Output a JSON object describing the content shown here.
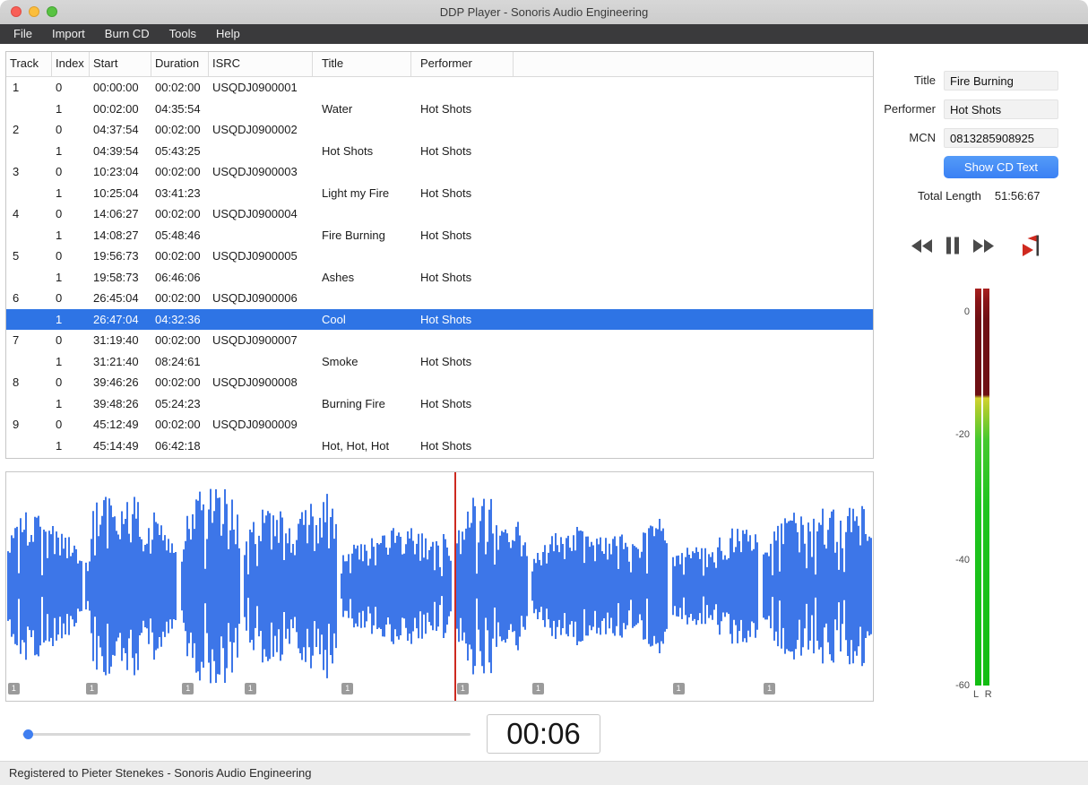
{
  "window": {
    "title": "DDP Player - Sonoris Audio Engineering"
  },
  "menu": {
    "items": [
      "File",
      "Import",
      "Burn CD",
      "Tools",
      "Help"
    ]
  },
  "table": {
    "columns": [
      "Track",
      "Index",
      "Start",
      "Duration",
      "ISRC",
      "Title",
      "Performer"
    ],
    "selected_row": 11,
    "rows": [
      {
        "track": "1",
        "index": "0",
        "start": "00:00:00",
        "duration": "00:02:00",
        "isrc": "USQDJ0900001",
        "title": "",
        "performer": ""
      },
      {
        "track": "",
        "index": "1",
        "start": "00:02:00",
        "duration": "04:35:54",
        "isrc": "",
        "title": "Water",
        "performer": "Hot Shots"
      },
      {
        "track": "2",
        "index": "0",
        "start": "04:37:54",
        "duration": "00:02:00",
        "isrc": "USQDJ0900002",
        "title": "",
        "performer": ""
      },
      {
        "track": "",
        "index": "1",
        "start": "04:39:54",
        "duration": "05:43:25",
        "isrc": "",
        "title": "Hot Shots",
        "performer": "Hot Shots"
      },
      {
        "track": "3",
        "index": "0",
        "start": "10:23:04",
        "duration": "00:02:00",
        "isrc": "USQDJ0900003",
        "title": "",
        "performer": ""
      },
      {
        "track": "",
        "index": "1",
        "start": "10:25:04",
        "duration": "03:41:23",
        "isrc": "",
        "title": "Light my Fire",
        "performer": "Hot Shots"
      },
      {
        "track": "4",
        "index": "0",
        "start": "14:06:27",
        "duration": "00:02:00",
        "isrc": "USQDJ0900004",
        "title": "",
        "performer": ""
      },
      {
        "track": "",
        "index": "1",
        "start": "14:08:27",
        "duration": "05:48:46",
        "isrc": "",
        "title": "Fire Burning",
        "performer": "Hot Shots"
      },
      {
        "track": "5",
        "index": "0",
        "start": "19:56:73",
        "duration": "00:02:00",
        "isrc": "USQDJ0900005",
        "title": "",
        "performer": ""
      },
      {
        "track": "",
        "index": "1",
        "start": "19:58:73",
        "duration": "06:46:06",
        "isrc": "",
        "title": "Ashes",
        "performer": "Hot Shots"
      },
      {
        "track": "6",
        "index": "0",
        "start": "26:45:04",
        "duration": "00:02:00",
        "isrc": "USQDJ0900006",
        "title": "",
        "performer": ""
      },
      {
        "track": "",
        "index": "1",
        "start": "26:47:04",
        "duration": "04:32:36",
        "isrc": "",
        "title": "Cool",
        "performer": "Hot Shots"
      },
      {
        "track": "7",
        "index": "0",
        "start": "31:19:40",
        "duration": "00:02:00",
        "isrc": "USQDJ0900007",
        "title": "",
        "performer": ""
      },
      {
        "track": "",
        "index": "1",
        "start": "31:21:40",
        "duration": "08:24:61",
        "isrc": "",
        "title": "Smoke",
        "performer": "Hot Shots"
      },
      {
        "track": "8",
        "index": "0",
        "start": "39:46:26",
        "duration": "00:02:00",
        "isrc": "USQDJ0900008",
        "title": "",
        "performer": ""
      },
      {
        "track": "",
        "index": "1",
        "start": "39:48:26",
        "duration": "05:24:23",
        "isrc": "",
        "title": "Burning Fire",
        "performer": "Hot Shots"
      },
      {
        "track": "9",
        "index": "0",
        "start": "45:12:49",
        "duration": "00:02:00",
        "isrc": "USQDJ0900009",
        "title": "",
        "performer": ""
      },
      {
        "track": "",
        "index": "1",
        "start": "45:14:49",
        "duration": "06:42:18",
        "isrc": "",
        "title": "Hot, Hot, Hot",
        "performer": "Hot Shots"
      }
    ]
  },
  "cd_text_panel": {
    "fields": [
      {
        "label": "Title",
        "value": "Fire Burning"
      },
      {
        "label": "Performer",
        "value": "Hot Shots"
      },
      {
        "label": "MCN",
        "value": "0813285908925"
      }
    ],
    "button": "Show CD Text",
    "total_length_label": "Total Length",
    "total_length_value": "51:56:67"
  },
  "transport": {
    "buttons": [
      "rewind",
      "pause",
      "fast-forward",
      "play-to-marker"
    ]
  },
  "meter": {
    "scale_labels": [
      "0",
      "-20",
      "-40",
      "-60"
    ],
    "channel_labels": "L R"
  },
  "waveform": {
    "color": "#3d76e8",
    "playhead_color": "#cd2a20",
    "playhead_position": 0.517,
    "segments": [
      {
        "start": 0.002,
        "end": 0.088,
        "marker": "1"
      },
      {
        "start": 0.092,
        "end": 0.197,
        "marker": "1"
      },
      {
        "start": 0.203,
        "end": 0.269,
        "marker": "1"
      },
      {
        "start": 0.275,
        "end": 0.381,
        "marker": "1"
      },
      {
        "start": 0.387,
        "end": 0.513,
        "marker": "1"
      },
      {
        "start": 0.52,
        "end": 0.601,
        "marker": "1"
      },
      {
        "start": 0.607,
        "end": 0.763,
        "marker": "1"
      },
      {
        "start": 0.769,
        "end": 0.868,
        "marker": "1"
      },
      {
        "start": 0.874,
        "end": 0.998,
        "marker": "1"
      }
    ]
  },
  "timeline": {
    "position": 0.012,
    "time_display": "00:06"
  },
  "status_bar": {
    "text": "Registered to Pieter Stenekes - Sonoris Audio Engineering"
  },
  "colors": {
    "accent_blue": "#3e87f6",
    "selection_blue": "#2e74e5",
    "waveform_blue": "#3d76e8",
    "playhead_red": "#cd2a20",
    "meter_green": "#1fc41f",
    "meter_yellow": "#d2d32f",
    "meter_red": "#6e1014"
  }
}
